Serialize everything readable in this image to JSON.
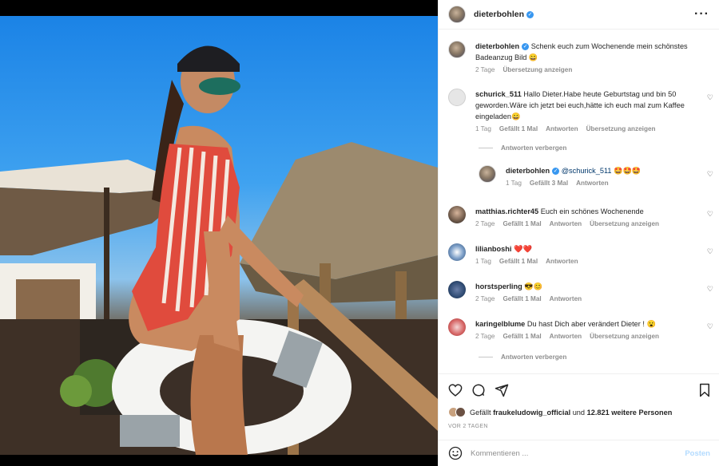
{
  "post": {
    "author": "dieterbohlen",
    "caption": "Schenk euch zum Wochenende mein schönstes Badeanzug Bild 😄",
    "caption_age": "2 Tage",
    "translate": "Übersetzung anzeigen"
  },
  "comments": [
    {
      "user": "schurick_511",
      "text": "Hallo Dieter.Habe heute Geburtstag und bin 50 geworden.Wäre ich jetzt bei euch,hätte ich euch mal zum Kaffee eingeladen😄",
      "age": "1 Tag",
      "likes": "Gefällt 1 Mal",
      "reply": "Antworten",
      "translate": "Übersetzung anzeigen",
      "hide_replies": "Antworten verbergen"
    },
    {
      "user": "dieterbohlen",
      "mention": "@schurick_511",
      "text": "🤩🤩🤩",
      "age": "1 Tag",
      "likes": "Gefällt 3 Mal",
      "reply": "Antworten"
    },
    {
      "user": "matthias.richter45",
      "text": "Euch ein schönes Wochenende",
      "age": "2 Tage",
      "likes": "Gefällt 1 Mal",
      "reply": "Antworten",
      "translate": "Übersetzung anzeigen"
    },
    {
      "user": "lilianboshi",
      "text": "❤️❤️",
      "age": "1 Tag",
      "likes": "Gefällt 1 Mal",
      "reply": "Antworten"
    },
    {
      "user": "horstsperling",
      "text": "😎😊",
      "age": "2 Tage",
      "likes": "Gefällt 1 Mal",
      "reply": "Antworten"
    },
    {
      "user": "karingelblume",
      "text": "Du hast Dich aber verändert Dieter ! 😮",
      "age": "2 Tage",
      "likes": "Gefällt 1 Mal",
      "reply": "Antworten",
      "translate": "Übersetzung anzeigen",
      "hide_replies": "Antworten verbergen"
    }
  ],
  "likes_line": {
    "prefix": "Gefällt",
    "first_user": "fraukeludowig_official",
    "middle": "und",
    "rest": "12.821 weitere Personen"
  },
  "posted": "VOR 2 TAGEN",
  "composer": {
    "placeholder": "Kommentieren ...",
    "post_label": "Posten"
  },
  "icons": [
    "more-icon",
    "verified-icon",
    "heart-icon",
    "comment-icon",
    "share-icon",
    "bookmark-icon",
    "emoji-icon"
  ],
  "colors": {
    "link": "#00376b",
    "verified": "#3897f0",
    "post_button": "#b3dbff",
    "muted": "#8e8e8e"
  }
}
